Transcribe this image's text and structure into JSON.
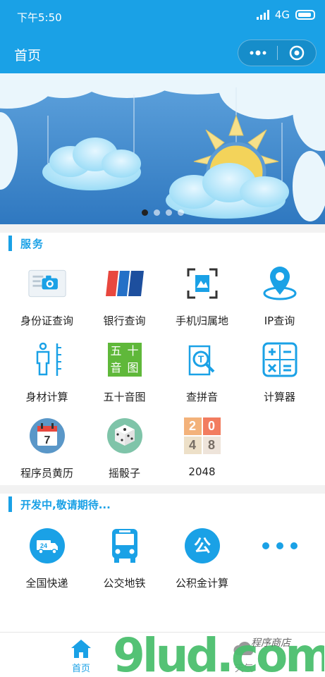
{
  "status": {
    "time": "下午5:50",
    "network": "4G"
  },
  "nav": {
    "title": "首页"
  },
  "banner": {
    "dot_count": 4,
    "active_dot": 0
  },
  "services": {
    "title": "服务",
    "items": [
      {
        "label": "身份证查询",
        "icon": "id-card-icon"
      },
      {
        "label": "银行查询",
        "icon": "bank-card-icon"
      },
      {
        "label": "手机归属地",
        "icon": "phone-location-icon"
      },
      {
        "label": "IP查询",
        "icon": "ip-location-icon"
      },
      {
        "label": "身材计算",
        "icon": "body-measure-icon"
      },
      {
        "label": "五十音图",
        "icon": "kana-chart-icon",
        "glyphs": [
          "五",
          "十",
          "音",
          "图"
        ]
      },
      {
        "label": "查拼音",
        "icon": "pinyin-search-icon",
        "glyph": "T"
      },
      {
        "label": "计算器",
        "icon": "calculator-icon"
      },
      {
        "label": "程序员黄历",
        "icon": "calendar-icon",
        "glyph": "7"
      },
      {
        "label": "摇骰子",
        "icon": "dice-icon"
      },
      {
        "label": "2048",
        "icon": "game-2048-icon",
        "glyphs": [
          "2",
          "0",
          "4",
          "8"
        ]
      }
    ]
  },
  "developing": {
    "title": "开发中,敬请期待...",
    "items": [
      {
        "label": "全国快递",
        "icon": "express-delivery-icon",
        "glyph": "24"
      },
      {
        "label": "公交地铁",
        "icon": "bus-icon"
      },
      {
        "label": "公积金计算",
        "icon": "housing-fund-icon",
        "glyph": "公"
      },
      {
        "label": "",
        "icon": "more-icon"
      }
    ]
  },
  "tabs": [
    {
      "label": "首页",
      "active": true
    },
    {
      "label": "天气",
      "active": false
    }
  ],
  "watermark": {
    "text": "9lud.com",
    "subtext": "程序商店"
  },
  "colors": {
    "primary": "#1aa1e6",
    "sky": "#3f8bd0"
  }
}
